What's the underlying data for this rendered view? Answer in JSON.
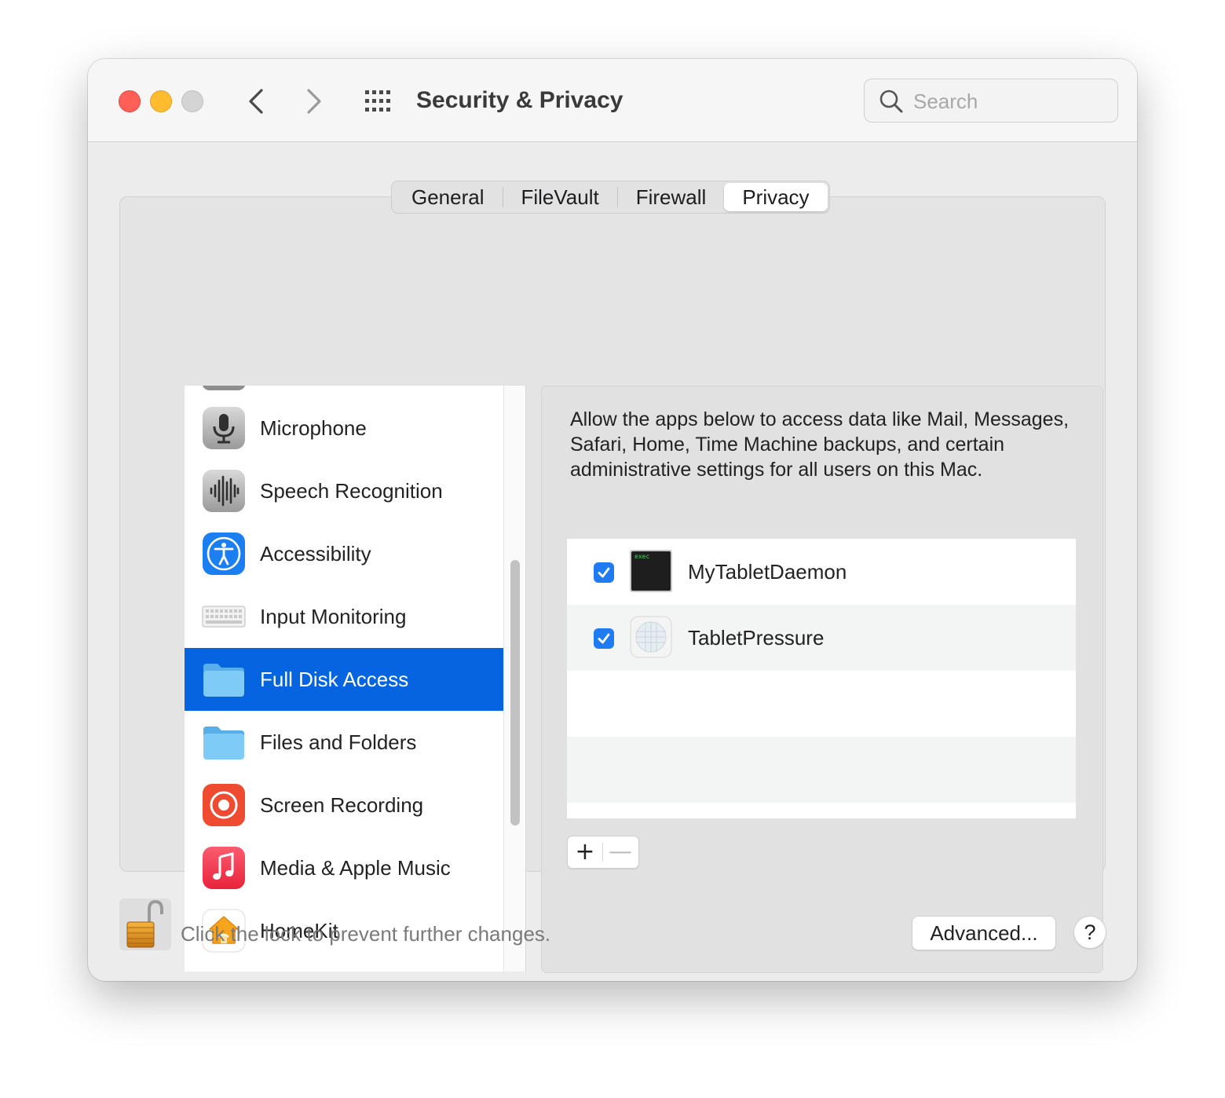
{
  "window": {
    "title": "Security & Privacy",
    "search_placeholder": "Search"
  },
  "tabs": [
    {
      "label": "General",
      "active": false
    },
    {
      "label": "FileVault",
      "active": false
    },
    {
      "label": "Firewall",
      "active": false
    },
    {
      "label": "Privacy",
      "active": true
    }
  ],
  "categories": [
    {
      "label": "Microphone",
      "icon": "microphone-icon",
      "selected": false
    },
    {
      "label": "Speech Recognition",
      "icon": "waveform-icon",
      "selected": false
    },
    {
      "label": "Accessibility",
      "icon": "accessibility-icon",
      "selected": false
    },
    {
      "label": "Input Monitoring",
      "icon": "keyboard-icon",
      "selected": false
    },
    {
      "label": "Full Disk Access",
      "icon": "folder-icon",
      "selected": true
    },
    {
      "label": "Files and Folders",
      "icon": "folder-icon",
      "selected": false
    },
    {
      "label": "Screen Recording",
      "icon": "record-icon",
      "selected": false
    },
    {
      "label": "Media & Apple Music",
      "icon": "music-note-icon",
      "selected": false
    },
    {
      "label": "HomeKit",
      "icon": "home-icon",
      "selected": false
    }
  ],
  "detail": {
    "description": "Allow the apps below to access data like Mail, Messages, Safari, Home, Time Machine backups, and certain administrative settings for all users on this Mac.",
    "apps": [
      {
        "name": "MyTabletDaemon",
        "checked": true,
        "icon": "terminal-exec-icon",
        "icon_text": "exec"
      },
      {
        "name": "TabletPressure",
        "checked": true,
        "icon": "app-grid-icon"
      }
    ],
    "add_label": "+",
    "remove_label": "—"
  },
  "footer": {
    "lock_text": "Click the lock to prevent further changes.",
    "advanced_label": "Advanced...",
    "help_label": "?"
  },
  "colors": {
    "selection": "#0664e0",
    "checkbox": "#1f7bf2",
    "close": "#fe5f57",
    "minimize": "#febc2e"
  }
}
